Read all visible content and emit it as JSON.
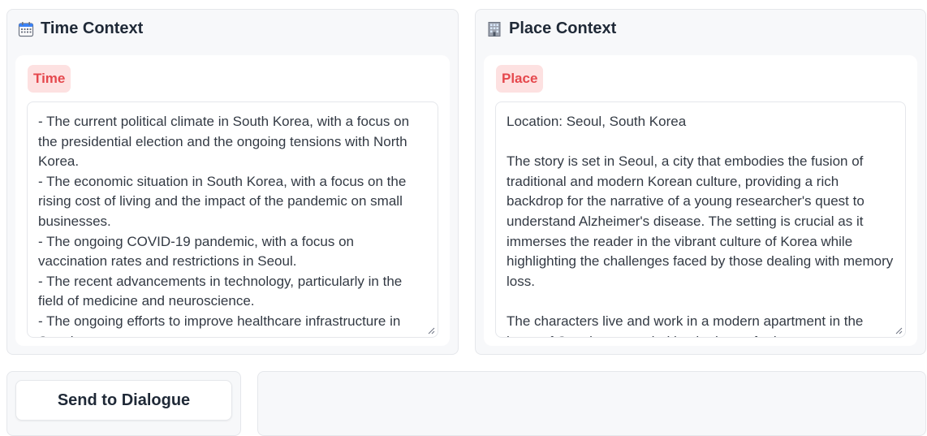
{
  "time_panel": {
    "title": "Time Context",
    "icon": "calendar-icon",
    "chip_label": "Time",
    "text": "- The current political climate in South Korea, with a focus on the presidential election and the ongoing tensions with North Korea.\n- The economic situation in South Korea, with a focus on the rising cost of living and the impact of the pandemic on small businesses.\n- The ongoing COVID-19 pandemic, with a focus on vaccination rates and restrictions in Seoul.\n- The recent advancements in technology, particularly in the field of medicine and neuroscience.\n- The ongoing efforts to improve healthcare infrastructure in Seoul"
  },
  "place_panel": {
    "title": "Place Context",
    "icon": "office-building-icon",
    "chip_label": "Place",
    "text": "Location: Seoul, South Korea\n\nThe story is set in Seoul, a city that embodies the fusion of traditional and modern Korean culture, providing a rich backdrop for the narrative of a young researcher's quest to understand Alzheimer's disease. The setting is crucial as it immerses the reader in the vibrant culture of Korea while highlighting the challenges faced by those dealing with memory loss.\n\nThe characters live and work in a modern apartment in the heart of Seoul, surrounded by the hum of urban"
  },
  "actions": {
    "send_label": "Send to Dialogue"
  },
  "colors": {
    "chip_bg": "#fde1e1",
    "chip_text": "#e5484d",
    "panel_bg": "#f7f8fa"
  }
}
